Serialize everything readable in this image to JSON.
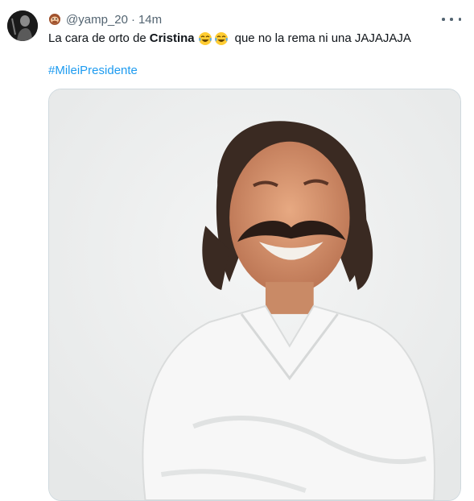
{
  "tweet": {
    "avatar_icon": "user-avatar",
    "handle": "@yamp_20",
    "separator": "·",
    "time": "14m",
    "text_before": "La cara de orto de",
    "text_bold": "Cristina",
    "text_after": "que no la rema ni una JAJAJAJA",
    "emoji_name": "speak-no-evil-monkey",
    "laugh_emojis": [
      "face-with-tears-of-joy",
      "face-with-tears-of-joy"
    ],
    "hashtag": "#MileiPresidente",
    "more_icon": "more-options-icon",
    "media_description_icon": "photo"
  },
  "colors": {
    "text_primary": "#0f1419",
    "text_secondary": "#536471",
    "link": "#1d9bf0",
    "border": "#cfd9de"
  }
}
